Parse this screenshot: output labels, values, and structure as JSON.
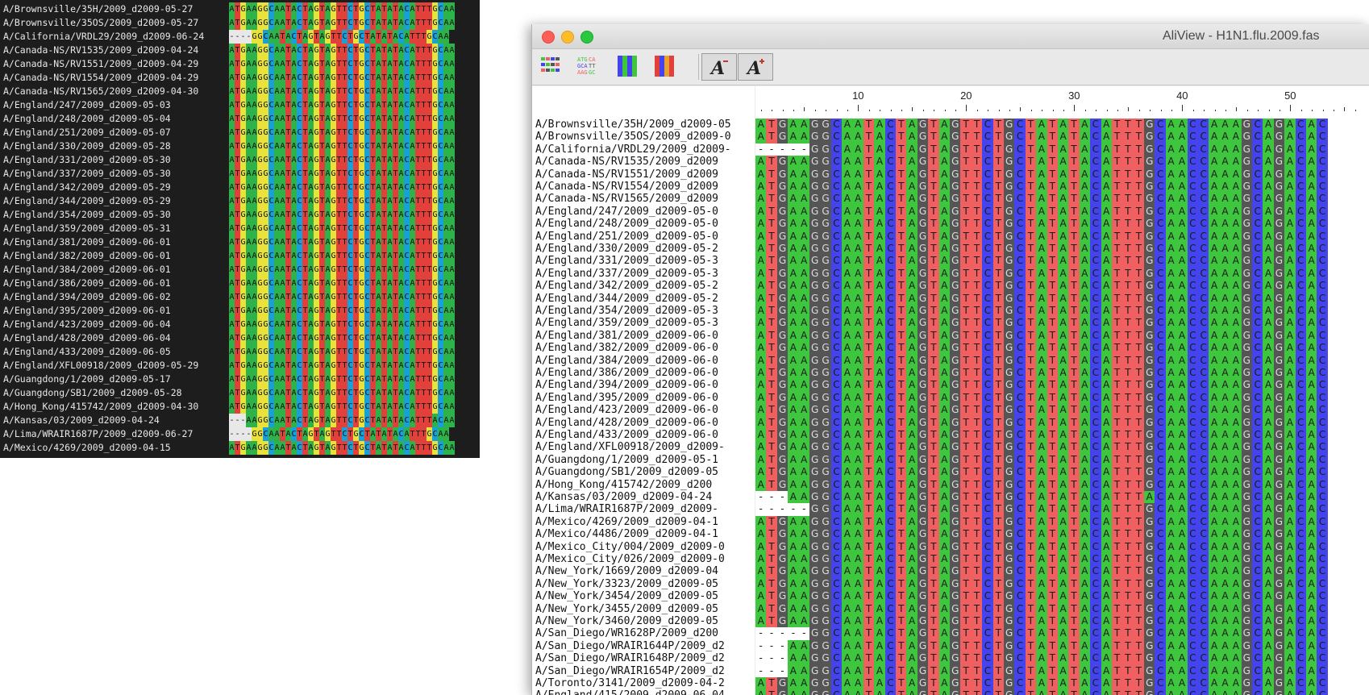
{
  "terminal": {
    "names": [
      "A/Brownsville/35H/2009_d2009-05-27",
      "A/Brownsville/35OS/2009_d2009-05-27",
      "A/California/VRDL29/2009_d2009-06-24",
      "A/Canada-NS/RV1535/2009_d2009-04-24",
      "A/Canada-NS/RV1551/2009_d2009-04-29",
      "A/Canada-NS/RV1554/2009_d2009-04-29",
      "A/Canada-NS/RV1565/2009_d2009-04-30",
      "A/England/247/2009_d2009-05-03",
      "A/England/248/2009_d2009-05-04",
      "A/England/251/2009_d2009-05-07",
      "A/England/330/2009_d2009-05-28",
      "A/England/331/2009_d2009-05-30",
      "A/England/337/2009_d2009-05-30",
      "A/England/342/2009_d2009-05-29",
      "A/England/344/2009_d2009-05-29",
      "A/England/354/2009_d2009-05-30",
      "A/England/359/2009_d2009-05-31",
      "A/England/381/2009_d2009-06-01",
      "A/England/382/2009_d2009-06-01",
      "A/England/384/2009_d2009-06-01",
      "A/England/386/2009_d2009-06-01",
      "A/England/394/2009_d2009-06-02",
      "A/England/395/2009_d2009-06-01",
      "A/England/423/2009_d2009-06-04",
      "A/England/428/2009_d2009-06-04",
      "A/England/433/2009_d2009-06-05",
      "A/England/XFL00918/2009_d2009-05-29",
      "A/Guangdong/1/2009_d2009-05-17",
      "A/Guangdong/SB1/2009_d2009-05-28",
      "A/Hong_Kong/415742/2009_d2009-04-30",
      "A/Kansas/03/2009_d2009-04-24",
      "A/Lima/WRAIR1687P/2009_d2009-06-27",
      "A/Mexico/4269/2009_d2009-04-15"
    ],
    "sequences": [
      "ATGAAGGCAATACTAGTAGTTCTGCTATATACATTTGCAA",
      "ATGAAGGCAATACTAGTAGTTCTGCTATATACATTTGCAA",
      "----GGCAATACTAGTAGTTCTGCTATATACATTTGCAA",
      "ATGAAGGCAATACTAGTAGTTCTGCTATATACATTTGCAA",
      "ATGAAGGCAATACTAGTAGTTCTGCTATATACATTTGCAA",
      "ATGAAGGCAATACTAGTAGTTCTGCTATATACATTTGCAA",
      "ATGAAGGCAATACTAGTAGTTCTGCTATATACATTTGCAA",
      "ATGAAGGCAATACTAGTAGTTCTGCTATATACATTTGCAA",
      "ATGAAGGCAATACTAGTAGTTCTGCTATATACATTTGCAA",
      "ATGAAGGCAATACTAGTAGTTCTGCTATATACATTTGCAA",
      "ATGAAGGCAATACTAGTAGTTCTGCTATATACATTTGCAA",
      "ATGAAGGCAATACTAGTAGTTCTGCTATATACATTTGCAA",
      "ATGAAGGCAATACTAGTAGTTCTGCTATATACATTTGCAA",
      "ATGAAGGCAATACTAGTAGTTCTGCTATATACATTTGCAA",
      "ATGAAGGCAATACTAGTAGTTCTGCTATATACATTTGCAA",
      "ATGAAGGCAATACTAGTAGTTCTGCTATATACATTTGCAA",
      "ATGAAGGCAATACTAGTAGTTCTGCTATATACATTTGCAA",
      "ATGAAGGCAATACTAGTAGTTCTGCTATATACATTTGCAA",
      "ATGAAGGCAATACTAGTAGTTCTGCTATATACATTTGCAA",
      "ATGAAGGCAATACTAGTAGTTCTGCTATATACATTTGCAA",
      "ATGAAGGCAATACTAGTAGTTCTGCTATATACATTTGCAA",
      "ATGAAGGCAATACTAGTAGTTCTGCTATATACATTTGCAA",
      "ATGAAGGCAATACTAGTAGTTCTGCTATATACATTTGCAA",
      "ATGAAGGCAATACTAGTAGTTCTGCTATATACATTTGCAA",
      "ATGAAGGCAATACTAGTAGTTCTGCTATATACATTTGCAA",
      "ATGAAGGCAATACTAGTAGTTCTGCTATATACATTTGCAA",
      "ATGAAGGCAATACTAGTAGTTCTGCTATATACATTTGCAA",
      "ATGAAGGCAATACTAGTAGTTCTGCTATATACATTTGCAA",
      "ATGAAGGCAATACTAGTAGTTCTGCTATATACATTTGCAA",
      "ATGAAGGCAATACTAGTAGTTCTGCTATATACATTTGCAA",
      "---AAGGCAATACTAGTAGTTCTGCTATATACATTTACAA",
      "----GGCAATACTAGTAGTTCTGCTATATACATTTGCAA",
      "ATGAAGGCAATACTAGTAGTTCTGCTATATACATTTGCAA"
    ]
  },
  "aliview": {
    "title": "AliView - H1N1.flu.2009.fas",
    "ruler_labels": [
      "10",
      "20",
      "30",
      "40",
      "50"
    ],
    "names": [
      "A/Brownsville/35H/2009_d2009-05",
      "A/Brownsville/35OS/2009_d2009-0",
      "A/California/VRDL29/2009_d2009-",
      "A/Canada-NS/RV1535/2009_d2009",
      "A/Canada-NS/RV1551/2009_d2009",
      "A/Canada-NS/RV1554/2009_d2009",
      "A/Canada-NS/RV1565/2009_d2009",
      "A/England/247/2009_d2009-05-0",
      "A/England/248/2009_d2009-05-0",
      "A/England/251/2009_d2009-05-0",
      "A/England/330/2009_d2009-05-2",
      "A/England/331/2009_d2009-05-3",
      "A/England/337/2009_d2009-05-3",
      "A/England/342/2009_d2009-05-2",
      "A/England/344/2009_d2009-05-2",
      "A/England/354/2009_d2009-05-3",
      "A/England/359/2009_d2009-05-3",
      "A/England/381/2009_d2009-06-0",
      "A/England/382/2009_d2009-06-0",
      "A/England/384/2009_d2009-06-0",
      "A/England/386/2009_d2009-06-0",
      "A/England/394/2009_d2009-06-0",
      "A/England/395/2009_d2009-06-0",
      "A/England/423/2009_d2009-06-0",
      "A/England/428/2009_d2009-06-0",
      "A/England/433/2009_d2009-06-0",
      "A/England/XFL00918/2009_d2009-",
      "A/Guangdong/1/2009_d2009-05-1",
      "A/Guangdong/SB1/2009_d2009-05",
      "A/Hong_Kong/415742/2009_d200",
      "A/Kansas/03/2009_d2009-04-24",
      "A/Lima/WRAIR1687P/2009_d2009-",
      "A/Mexico/4269/2009_d2009-04-1",
      "A/Mexico/4486/2009_d2009-04-1",
      "A/Mexico_City/004/2009_d2009-0",
      "A/Mexico_City/026/2009_d2009-0",
      "A/New_York/1669/2009_d2009-04",
      "A/New_York/3323/2009_d2009-05",
      "A/New_York/3454/2009_d2009-05",
      "A/New_York/3455/2009_d2009-05",
      "A/New_York/3460/2009_d2009-05",
      "A/San_Diego/WR1628P/2009_d200",
      "A/San_Diego/WRAIR1644P/2009_d2",
      "A/San_Diego/WRAIR1648P/2009_d2",
      "A/San_Diego/WRAIR1654P/2009_d2",
      "A/Toronto/3141/2009_d2009-04-2",
      "A/England/415/2009_d2009-06-04"
    ],
    "sequences": [
      "ATGAAGGCAATACTAGTAGTTCTGCTATATACATTTGCAACCAAAGCAGACAC",
      "ATGAAGGCAATACTAGTAGTTCTGCTATATACATTTGCAACCAAAGCAGACAC",
      "-----GGCAATACTAGTAGTTCTGCTATATACATTTGCAACCAAAGCAGACAC",
      "ATGAAGGCAATACTAGTAGTTCTGCTATATACATTTGCAACCAAAGCAGACAC",
      "ATGAAGGCAATACTAGTAGTTCTGCTATATACATTTGCAACCAAAGCAGACAC",
      "ATGAAGGCAATACTAGTAGTTCTGCTATATACATTTGCAACCAAAGCAGACAC",
      "ATGAAGGCAATACTAGTAGTTCTGCTATATACATTTGCAACCAAAGCAGACAC",
      "ATGAAGGCAATACTAGTAGTTCTGCTATATACATTTGCAACCAAAGCAGACAC",
      "ATGAAGGCAATACTAGTAGTTCTGCTATATACATTTGCAACCAAAGCAGACAC",
      "ATGAAGGCAATACTAGTAGTTCTGCTATATACATTTGCAACCAAAGCAGACAC",
      "ATGAAGGCAATACTAGTAGTTCTGCTATATACATTTGCAACCAAAGCAGACAC",
      "ATGAAGGCAATACTAGTAGTTCTGCTATATACATTTGCAACCAAAGCAGACAC",
      "ATGAAGGCAATACTAGTAGTTCTGCTATATACATTTGCAACCAAAGCAGACAC",
      "ATGAAGGCAATACTAGTAGTTCTGCTATATACATTTGCAACCAAAGCAGACAC",
      "ATGAAGGCAATACTAGTAGTTCTGCTATATACATTTGCAACCAAAGCAGACAC",
      "ATGAAGGCAATACTAGTAGTTCTGCTATATACATTTGCAACCAAAGCAGACAC",
      "ATGAAGGCAATACTAGTAGTTCTGCTATATACATTTGCAACCAAAGCAGACAC",
      "ATGAAGGCAATACTAGTAGTTCTGCTATATACATTTGCAACCAAAGCAGACAC",
      "ATGAAGGCAATACTAGTAGTTCTGCTATATACATTTGCAACCAAAGCAGACAC",
      "ATGAAGGCAATACTAGTAGTTCTGCTATATACATTTGCAACCAAAGCAGACAC",
      "ATGAAGGCAATACTAGTAGTTCTGCTATATACATTTGCAACCAAAGCAGACAC",
      "ATGAAGGCAATACTAGTAGTTCTGCTATATACATTTGCAACCAAAGCAGACAC",
      "ATGAAGGCAATACTAGTAGTTCTGCTATATACATTTGCAACCAAAGCAGACAC",
      "ATGAAGGCAATACTAGTAGTTCTGCTATATACATTTGCAACCAAAGCAGACAC",
      "ATGAAGGCAATACTAGTAGTTCTGCTATATACATTTGCAACCAAAGCAGACAC",
      "ATGAAGGCAATACTAGTAGTTCTGCTATATACATTTGCAACCAAAGCAGACAC",
      "ATGAAGGCAATACTAGTAGTTCTGCTATATACATTTGCAACCAAAGCAGACAC",
      "ATGAAGGCAATACTAGTAGTTCTGCTATATACATTTGCAACCAAAGCAGACAC",
      "ATGAAGGCAATACTAGTAGTTCTGCTATATACATTTGCAACCAAAGCAGACAC",
      "ATGAAGGCAATACTAGTAGTTCTGCTATATACATTTGCAACCAAAGCAGACAC",
      "---AAGGCAATACTAGTAGTTCTGCTATATACATTTACAACCAAAGCAGACAC",
      "-----GGCAATACTAGTAGTTCTGCTATATACATTTGCAACCAAAGCAGACAC",
      "ATGAAGGCAATACTAGTAGTTCTGCTATATACATTTGCAACCAAAGCAGACAC",
      "ATGAAGGCAATACTAGTAGTTCTGCTATATACATTTGCAACCAAAGCAGACAC",
      "ATGAAGGCAATACTAGTAGTTCTGCTATATACATTTGCAACCAAAGCAGACAC",
      "ATGAAGGCAATACTAGTAGTTCTGCTATATACATTTGCAACCAAAGCAGACAC",
      "ATGAAGGCAATACTAGTAGTTCTGCTATATACATTTGCAACCAAAGCAGACAC",
      "ATGAAGGCAATACTAGTAGTTCTGCTATATACATTTGCAACCAAAGCAGACAC",
      "ATGAAGGCAATACTAGTAGTTCTGCTATATACATTTGCAACCAAAGCAGACAC",
      "ATGAAGGCAATACTAGTAGTTCTGCTATATACATTTGCAACCAAAGCAGACAC",
      "ATGAAGGCAATACTAGTAGTTCTGCTATATACATTTGCAACCAAAGCAGACAC",
      "-----GGCAATACTAGTAGTTCTGCTATATACATTTGCAACCAAAGCAGACAC",
      "---AAGGCAATACTAGTAGTTCTGCTATATACATTTGCAACCAAAGCAGACAC",
      "---AAGGCAATACTAGTAGTTCTGCTATATACATTTGCAACCAAAGCAGACAC",
      "---AAGGCAATACTAGTAGTTCTGCTATATACATTTGCAACCAAAGCAGACAC",
      "ATGAAGGCAATACTAGTAGTTCTGCTATATACATTTGCAACCAAAGCAGACAC",
      "ATGAAGGCAATACTAGTAGTTCTGCTATATACATTTGCAACCAAAGCAGACAC"
    ],
    "toolbar_icons": [
      "color-scheme-icon",
      "translate-icon",
      "nucleotide-color-icon",
      "codon-color-icon",
      "font-decrease-icon",
      "font-increase-icon"
    ]
  },
  "colors": {
    "A": "#3ec63e",
    "C": "#4444ee",
    "G": "#555555",
    "T": "#f06060",
    "gap": "#ffffff",
    "term_A": "#2db34a",
    "term_C": "#1aa0d8",
    "term_G": "#e8e23a",
    "term_T": "#e2403a"
  }
}
